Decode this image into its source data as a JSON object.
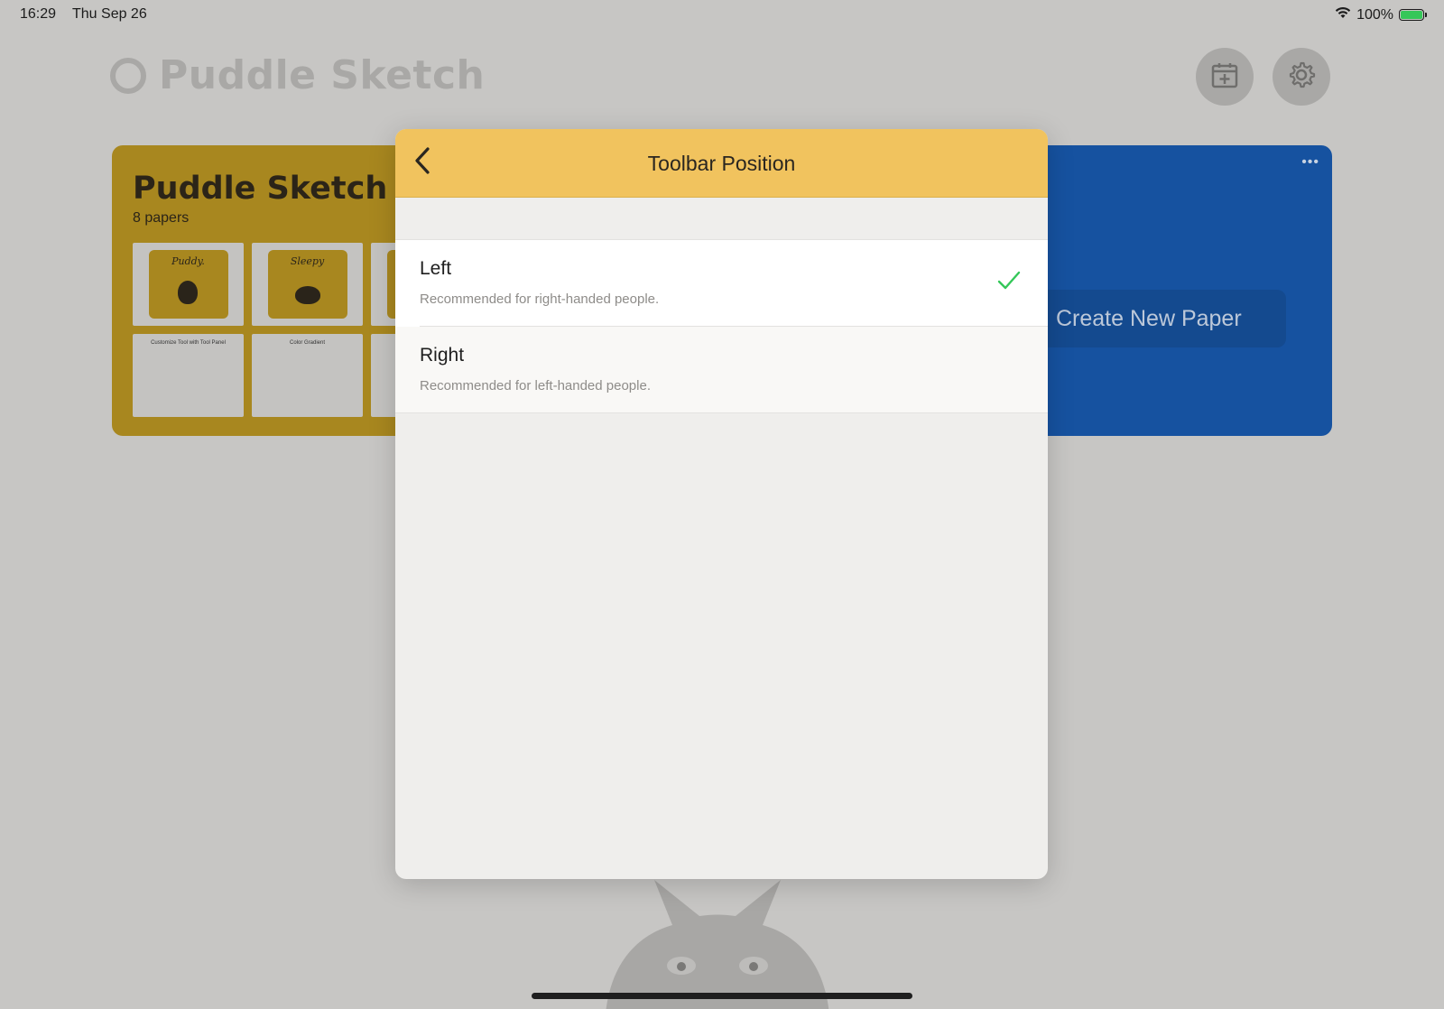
{
  "status_bar": {
    "time": "16:29",
    "date": "Thu Sep 26",
    "battery": "100%",
    "wifi_icon": "wifi-icon",
    "battery_icon": "battery-charging-icon"
  },
  "app": {
    "title": "Puddle Sketch",
    "calendar_icon": "calendar-plus-icon",
    "settings_icon": "gear-icon"
  },
  "album": {
    "title": "Puddle Sketch",
    "count": "8 papers",
    "thumbs": [
      {
        "label": "Puddy."
      },
      {
        "label": "Sleepy"
      },
      {
        "label": "Customize Tool with Tool Panel"
      },
      {
        "label": "Color Gradient"
      }
    ]
  },
  "blue_card": {
    "more": "•••",
    "create_label": "Create New Paper"
  },
  "modal": {
    "title": "Toolbar Position",
    "back_icon": "chevron-left-icon",
    "options": [
      {
        "label": "Left",
        "description": "Recommended for right-handed people.",
        "selected": true
      },
      {
        "label": "Right",
        "description": "Recommended for left-handed people.",
        "selected": false
      }
    ],
    "check_icon": "checkmark-icon",
    "colors": {
      "header": "#f1c35e",
      "check": "#34c759",
      "album": "#a8871f",
      "blue_card": "#1652a0"
    }
  }
}
